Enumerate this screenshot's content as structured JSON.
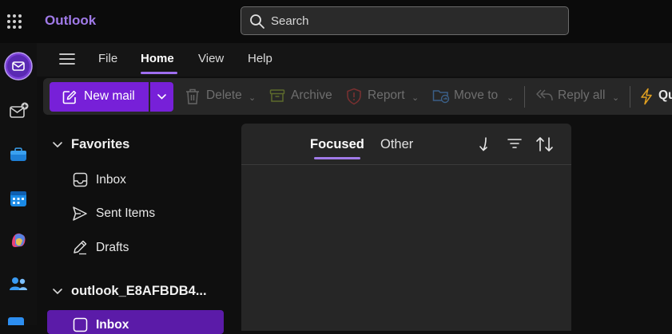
{
  "app": {
    "name": "Outlook"
  },
  "search": {
    "placeholder": "Search"
  },
  "menu": {
    "items": [
      "File",
      "Home",
      "View",
      "Help"
    ]
  },
  "ribbon": {
    "new_mail": "New mail",
    "delete": "Delete",
    "archive": "Archive",
    "report": "Report",
    "move_to": "Move to",
    "reply_all": "Reply all",
    "quick_steps": "Qu"
  },
  "folders": {
    "favorites_title": "Favorites",
    "favorites": [
      "Inbox",
      "Sent Items",
      "Drafts"
    ],
    "account_title": "outlook_E8AFBDB4...",
    "account_first": "Inbox"
  },
  "message_list": {
    "tabs": [
      "Focused",
      "Other"
    ]
  },
  "colors": {
    "accent": "#7720d8",
    "brand": "#a07ae8",
    "selected": "#5b1ba8"
  },
  "icons": {
    "rail": [
      "mail-icon",
      "new-mail-icon",
      "briefcase-icon",
      "calendar-icon",
      "copilot-icon",
      "people-icon"
    ]
  }
}
